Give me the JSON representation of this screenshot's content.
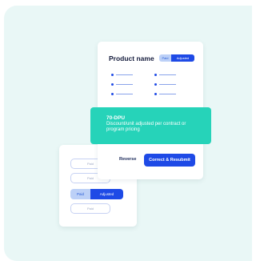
{
  "back_card": {
    "field_labels": [
      "Paid",
      "Paid",
      "Paid"
    ],
    "toggle": {
      "paid_label": "Paid",
      "adjusted_label": "Adjusted"
    }
  },
  "product_card": {
    "title": "Product name",
    "toggle": {
      "paid_label": "Paid",
      "adjusted_label": "Adjusted"
    }
  },
  "callout": {
    "title": "70-DPU",
    "body": "Discount/unit adjusted per contract or program pricing"
  },
  "actions": {
    "reverse_label": "Reverse",
    "resubmit_label": "Correct & Resubmit"
  },
  "colors": {
    "background": "#e9f7f6",
    "accent": "#1e4ae6",
    "teal": "#26d3b9",
    "light_blue": "#bcd0f7"
  }
}
